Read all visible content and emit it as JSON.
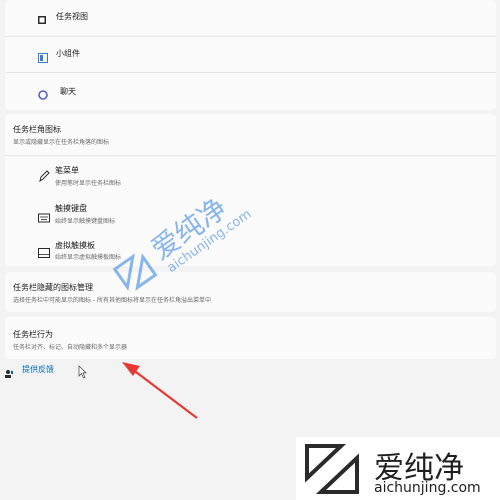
{
  "taskbar_items": {
    "task_view": "任务视图",
    "widgets": "小组件",
    "chat": "聊天"
  },
  "corner_icons": {
    "title": "任务栏角图标",
    "subtitle": "显示或隐藏显示在任务栏角落的图标",
    "pen_menu": {
      "title": "笔菜单",
      "subtitle": "使用笔时显示任务栏图标"
    },
    "touch_keyboard": {
      "title": "触摸键盘",
      "subtitle": "始终显示触摸键盘图标"
    },
    "virtual_touchpad": {
      "title": "虚拟触摸板",
      "subtitle": "始终显示虚拟触摸板图标"
    }
  },
  "overflow": {
    "title": "任务栏隐藏的图标管理",
    "subtitle": "选择任务栏中可能显示的图标 - 所有其他图标将显示在任务栏角溢出菜单中"
  },
  "behaviors": {
    "title": "任务栏行为",
    "subtitle": "任务栏对齐、标记、自动隐藏和多个显示器"
  },
  "feedback": {
    "label": "提供反馈"
  },
  "watermark": {
    "brand": "爱纯净",
    "url": "aichunjing.com"
  },
  "colors": {
    "arrow": "#e53935",
    "watermark_blue": "#2a7de1",
    "accent_blue": "#0067c0"
  }
}
